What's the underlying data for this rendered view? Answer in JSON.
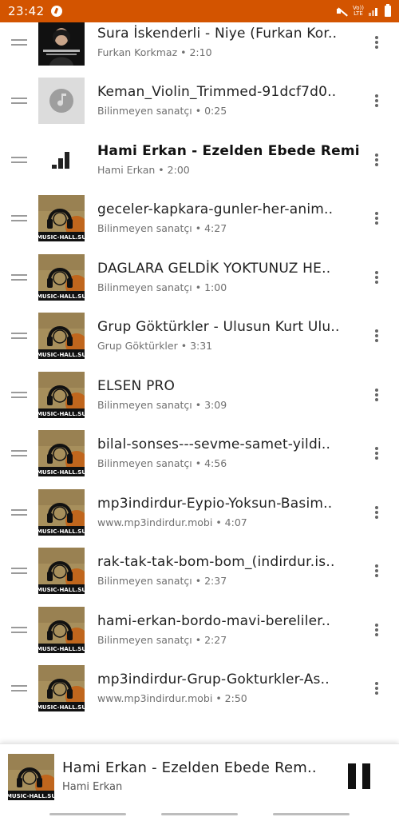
{
  "status_bar": {
    "time": "23:42",
    "lte_top": "Vo))",
    "lte_bottom": "LTE",
    "icons": [
      "app-notification-icon",
      "mute-icon",
      "lte-icon",
      "signal-icon",
      "battery-icon"
    ]
  },
  "tracks": [
    {
      "title": "Sura İskenderli - Niye (Furkan Kor..",
      "artist": "Furkan Korkmaz",
      "duration": "2:10",
      "art": "photo",
      "playing": false
    },
    {
      "title": "Keman_Violin_Trimmed-91dcf7d0..",
      "artist": "Bilinmeyen sanatçı",
      "duration": "0:25",
      "art": "placeholder",
      "playing": false
    },
    {
      "title": "Hami Erkan - Ezelden Ebede Remi..",
      "artist": "Hami Erkan",
      "duration": "2:00",
      "art": "now-playing",
      "playing": true
    },
    {
      "title": "geceler-kapkara-gunler-her-anim..",
      "artist": "Bilinmeyen sanatçı",
      "duration": "4:27",
      "art": "music-hall",
      "playing": false
    },
    {
      "title": "DAGLARA GELDİK YOKTUNUZ HE..",
      "artist": "Bilinmeyen sanatçı",
      "duration": "1:00",
      "art": "music-hall",
      "playing": false
    },
    {
      "title": "Grup Göktürkler - Ulusun Kurt Ulu..",
      "artist": "Grup Göktürkler",
      "duration": "3:31",
      "art": "music-hall",
      "playing": false
    },
    {
      "title": "ELSEN PRO",
      "artist": "Bilinmeyen sanatçı",
      "duration": "3:09",
      "art": "music-hall",
      "playing": false
    },
    {
      "title": "bilal-sonses---sevme-samet-yildi..",
      "artist": "Bilinmeyen sanatçı",
      "duration": "4:56",
      "art": "music-hall",
      "playing": false
    },
    {
      "title": "mp3indirdur-Eypio-Yoksun-Basim..",
      "artist": "www.mp3indirdur.mobi",
      "duration": "4:07",
      "art": "music-hall",
      "playing": false
    },
    {
      "title": "rak-tak-tak-bom-bom_(indirdur.is..",
      "artist": "Bilinmeyen sanatçı",
      "duration": "2:37",
      "art": "music-hall",
      "playing": false
    },
    {
      "title": "hami-erkan-bordo-mavi-bereliler..",
      "artist": "Bilinmeyen sanatçı",
      "duration": "2:27",
      "art": "music-hall",
      "playing": false
    },
    {
      "title": "mp3indirdur-Grup-Gokturkler-As..",
      "artist": "www.mp3indirdur.mobi",
      "duration": "2:50",
      "art": "music-hall",
      "playing": false
    }
  ],
  "separator": " • ",
  "art_label": "MUSIC-HALL.SU",
  "now_playing": {
    "title": "Hami Erkan - Ezelden Ebede Rem..",
    "artist": "Hami Erkan",
    "control_icon": "pause-icon"
  },
  "colors": {
    "status_bar": "#d35400",
    "art_bg": "#a78f5c",
    "art_accent": "#c0661d"
  }
}
